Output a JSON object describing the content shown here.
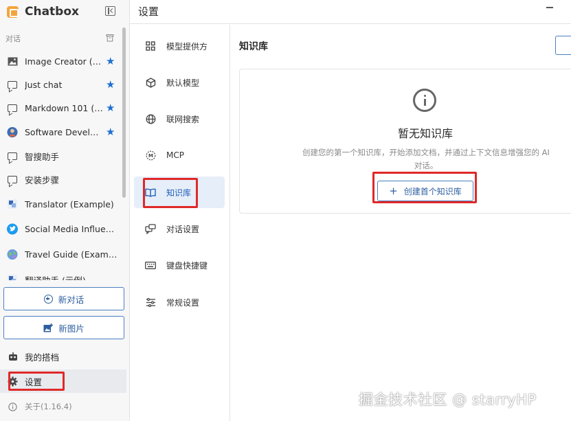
{
  "app": {
    "name": "Chatbox",
    "brand_color": "#f3a43c"
  },
  "sidebar": {
    "section_label": "对话",
    "conversations": [
      {
        "label": "Image Creator (E…",
        "icon": "image-icon",
        "starred": true
      },
      {
        "label": "Just chat",
        "icon": "chat-bubble-icon",
        "starred": true
      },
      {
        "label": "Markdown 101 (…",
        "icon": "chat-bubble-icon",
        "starred": true
      },
      {
        "label": "Software Develo…",
        "icon": "developer-avatar-icon",
        "starred": true
      },
      {
        "label": "智搜助手",
        "icon": "chat-bubble-icon",
        "starred": false
      },
      {
        "label": "安装步骤",
        "icon": "chat-bubble-icon",
        "starred": false
      },
      {
        "label": "Translator (Example)",
        "icon": "translator-avatar-icon",
        "starred": false
      },
      {
        "label": "Social Media Influenc…",
        "icon": "twitter-avatar-icon",
        "starred": false
      },
      {
        "label": "Travel Guide (Example)",
        "icon": "globe-avatar-icon",
        "starred": false
      },
      {
        "label": "翻译助手 (示例)",
        "icon": "translator-avatar-icon",
        "starred": false
      }
    ],
    "star_glyph": "★",
    "new_chat_label": "新对话",
    "new_image_label": "新图片",
    "my_copilots_label": "我的搭档",
    "settings_label": "设置",
    "about_label": "关于(1.16.4)",
    "accent_color": "#2d5fa0"
  },
  "header": {
    "title": "设置"
  },
  "settings_nav": {
    "items": [
      {
        "label": "模型提供方",
        "icon": "grid-icon",
        "active": false
      },
      {
        "label": "默认模型",
        "icon": "cube-icon",
        "active": false
      },
      {
        "label": "联网搜索",
        "icon": "globe-icon",
        "active": false
      },
      {
        "label": "MCP",
        "icon": "mcp-icon",
        "active": false
      },
      {
        "label": "知识库",
        "icon": "book-icon",
        "active": true
      },
      {
        "label": "对话设置",
        "icon": "chat-settings-icon",
        "active": false
      },
      {
        "label": "键盘快捷键",
        "icon": "keyboard-icon",
        "active": false
      },
      {
        "label": "常规设置",
        "icon": "sliders-icon",
        "active": false
      }
    ]
  },
  "main": {
    "title": "知识库",
    "empty_state": {
      "icon": "info-icon",
      "title": "暂无知识库",
      "description": "创建您的第一个知识库，开始添加文档，并通过上下文信息增强您的 AI 对话。",
      "create_button_plus": "+",
      "create_button_label": "创建首个知识库"
    }
  },
  "highlight_color": "#e02828",
  "watermark": "掘金技术社区 @ starryHP"
}
